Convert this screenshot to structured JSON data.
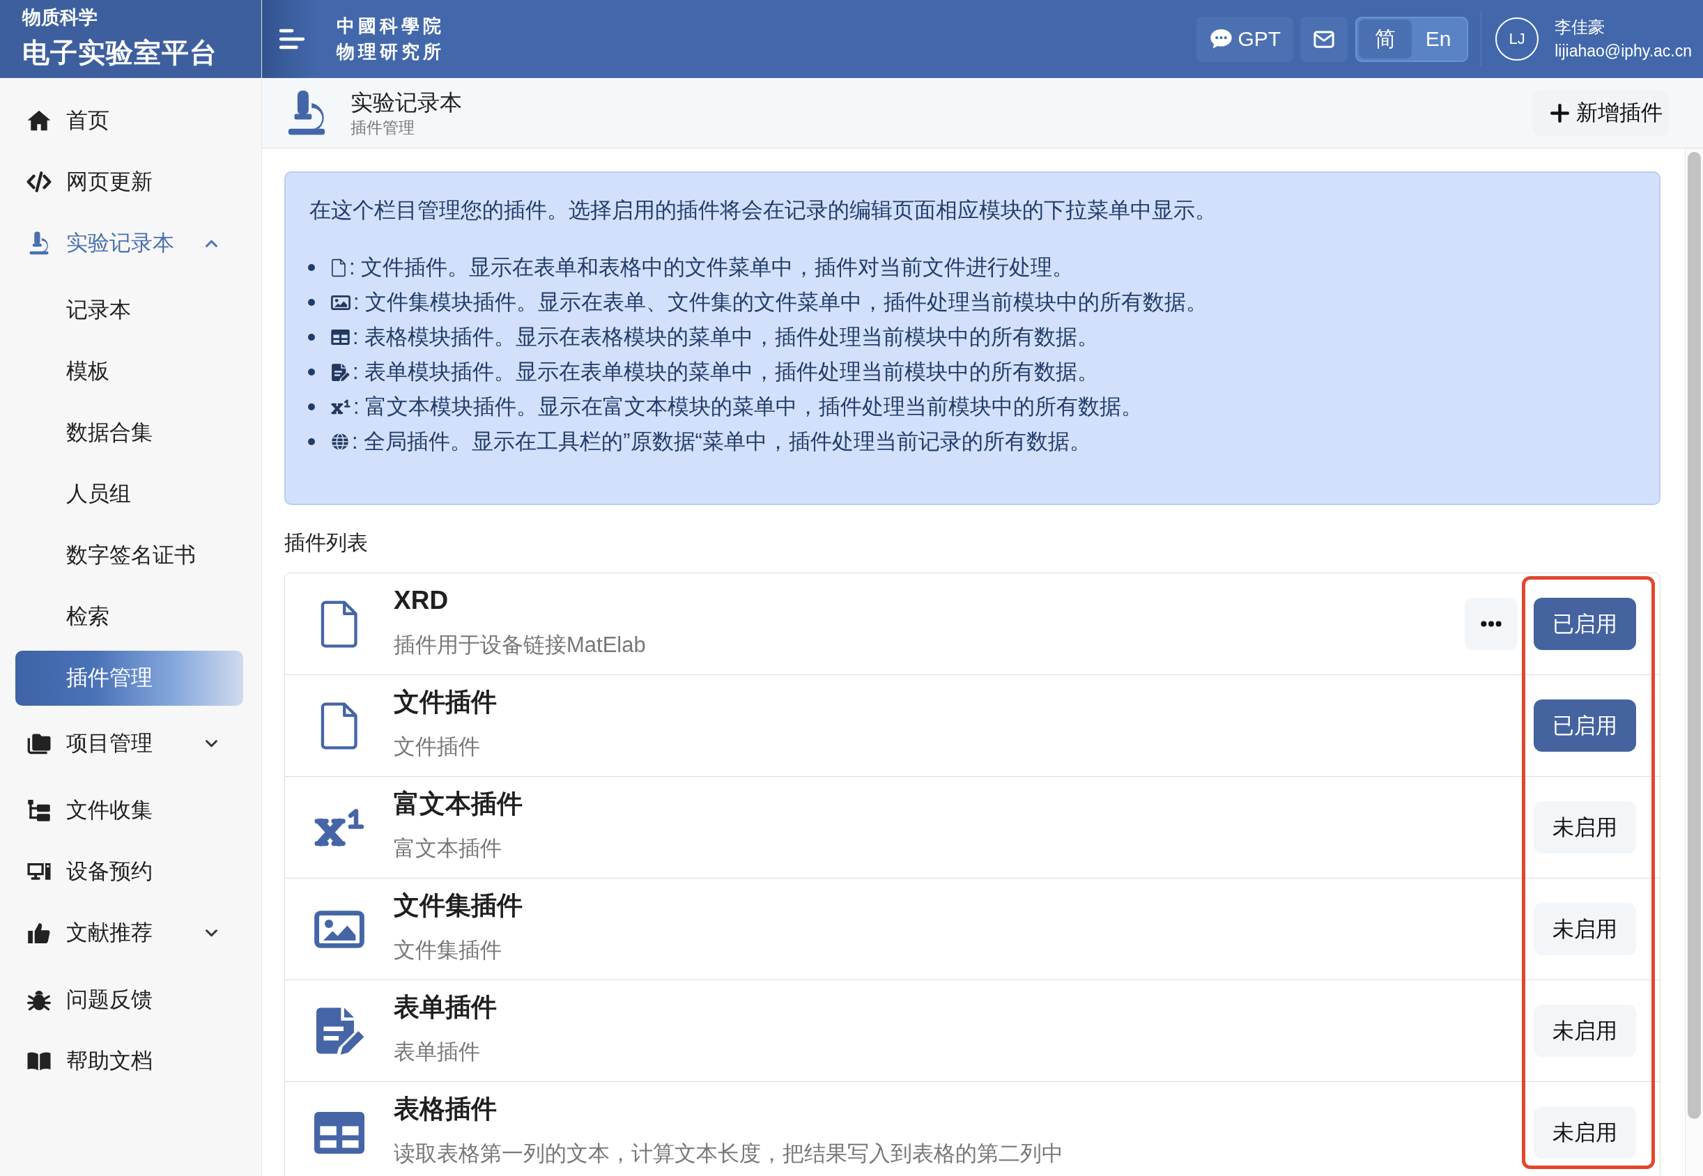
{
  "sidebar": {
    "brand": {
      "subtitle": "物质科学",
      "title": "电子实验室平台"
    },
    "items": [
      {
        "kind": "link",
        "label": "首页",
        "selected": false
      },
      {
        "kind": "link",
        "label": "网页更新",
        "selected": false
      },
      {
        "kind": "group",
        "label": "实验记录本",
        "selected": false,
        "expanded": true,
        "children": [
          {
            "label": "记录本",
            "selected": false
          },
          {
            "label": "模板",
            "selected": false
          },
          {
            "label": "数据合集",
            "selected": false
          },
          {
            "label": "人员组",
            "selected": false
          },
          {
            "label": "数字签名证书",
            "selected": false
          },
          {
            "label": "检索",
            "selected": false
          },
          {
            "label": "插件管理",
            "selected": true
          }
        ]
      },
      {
        "kind": "group",
        "label": "项目管理",
        "selected": false,
        "expanded": false
      },
      {
        "kind": "link",
        "label": "文件收集",
        "selected": false
      },
      {
        "kind": "link",
        "label": "设备预约",
        "selected": false
      },
      {
        "kind": "group",
        "label": "文献推荐",
        "selected": false,
        "expanded": false
      },
      {
        "kind": "link",
        "label": "问题反馈",
        "selected": false
      },
      {
        "kind": "link",
        "label": "帮助文档",
        "selected": false
      }
    ]
  },
  "top_bar": {
    "logo_lines": [
      "中國科學院",
      "物理研究所"
    ],
    "gpt_label": "GPT",
    "languages": [
      {
        "label": "简",
        "selected": true
      },
      {
        "label": "En",
        "selected": false
      }
    ],
    "user": {
      "initials": "LJ",
      "name": "李佳豪",
      "email": "lijiahao@iphy.ac.cn"
    }
  },
  "page_header": {
    "title": "实验记录本",
    "subtitle": "插件管理",
    "add_button": "新增插件"
  },
  "info": {
    "intro": "在这个栏目管理您的插件。选择启用的插件将会在记录的编辑页面相应模块的下拉菜单中显示。",
    "items": [
      {
        "kind": "file",
        "text": ": 文件插件。显示在表单和表格中的文件菜单中，插件对当前文件进行处理。"
      },
      {
        "kind": "fileset",
        "text": ": 文件集模块插件。显示在表单、文件集的文件菜单中，插件处理当前模块中的所有数据。"
      },
      {
        "kind": "table",
        "text": ": 表格模块插件。显示在表格模块的菜单中，插件处理当前模块中的所有数据。"
      },
      {
        "kind": "form",
        "text": ": 表单模块插件。显示在表单模块的菜单中，插件处理当前模块中的所有数据。"
      },
      {
        "kind": "richtext",
        "text": ": 富文本模块插件。显示在富文本模块的菜单中，插件处理当前模块中的所有数据。"
      },
      {
        "kind": "global",
        "text": ": 全局插件。显示在工具栏的”原数据“菜单中，插件处理当前记录的所有数据。"
      }
    ]
  },
  "plugin_list": {
    "title": "插件列表",
    "plugins": [
      {
        "kind": "file",
        "name": "XRD",
        "description": "插件用于设备链接MatElab",
        "has_menu": true,
        "enabled": true,
        "status": "已启用"
      },
      {
        "kind": "file",
        "name": "文件插件",
        "description": "文件插件",
        "has_menu": false,
        "enabled": true,
        "status": "已启用"
      },
      {
        "kind": "richtext",
        "name": "富文本插件",
        "description": "富文本插件",
        "has_menu": false,
        "enabled": false,
        "status": "未启用"
      },
      {
        "kind": "fileset",
        "name": "文件集插件",
        "description": "文件集插件",
        "has_menu": false,
        "enabled": false,
        "status": "未启用"
      },
      {
        "kind": "form",
        "name": "表单插件",
        "description": "表单插件",
        "has_menu": false,
        "enabled": false,
        "status": "未启用"
      },
      {
        "kind": "table",
        "name": "表格插件",
        "description": "读取表格第一列的文本，计算文本长度，把结果写入到表格的第二列中",
        "has_menu": false,
        "enabled": false,
        "status": "未启用"
      }
    ]
  },
  "annotation": {
    "kind": "frame"
  }
}
